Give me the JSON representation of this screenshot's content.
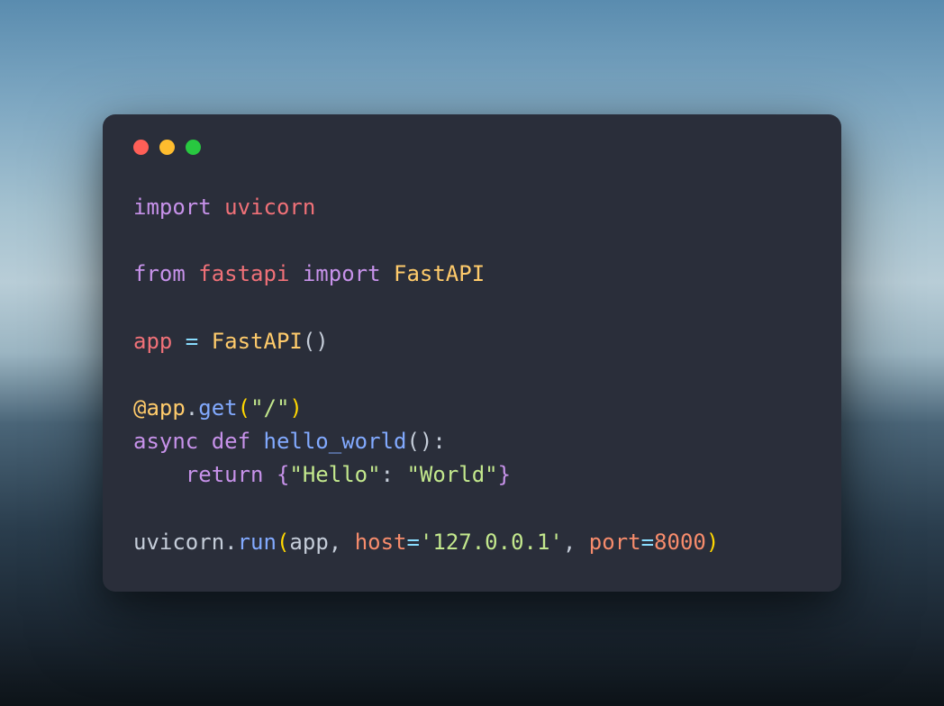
{
  "code": {
    "lines": [
      {
        "tokens": [
          {
            "t": "import ",
            "c": "tok-keyword"
          },
          {
            "t": "uvicorn",
            "c": "tok-module"
          }
        ]
      },
      {
        "tokens": [
          {
            "t": " ",
            "c": ""
          }
        ]
      },
      {
        "tokens": [
          {
            "t": "from ",
            "c": "tok-keyword"
          },
          {
            "t": "fastapi ",
            "c": "tok-module"
          },
          {
            "t": "import ",
            "c": "tok-keyword"
          },
          {
            "t": "FastAPI",
            "c": "tok-class"
          }
        ]
      },
      {
        "tokens": [
          {
            "t": " ",
            "c": ""
          }
        ]
      },
      {
        "tokens": [
          {
            "t": "app ",
            "c": "tok-name"
          },
          {
            "t": "= ",
            "c": "tok-op"
          },
          {
            "t": "FastAPI",
            "c": "tok-class"
          },
          {
            "t": "()",
            "c": "tok-punct"
          }
        ]
      },
      {
        "tokens": [
          {
            "t": " ",
            "c": ""
          }
        ]
      },
      {
        "tokens": [
          {
            "t": "@app",
            "c": "tok-attr"
          },
          {
            "t": ".",
            "c": "tok-punct"
          },
          {
            "t": "get",
            "c": "tok-method"
          },
          {
            "t": "(",
            "c": "tok-paren"
          },
          {
            "t": "\"/\"",
            "c": "tok-string"
          },
          {
            "t": ")",
            "c": "tok-paren"
          }
        ]
      },
      {
        "tokens": [
          {
            "t": "async ",
            "c": "tok-keyword"
          },
          {
            "t": "def ",
            "c": "tok-keyword"
          },
          {
            "t": "hello_world",
            "c": "tok-func"
          },
          {
            "t": "():",
            "c": "tok-punct"
          }
        ]
      },
      {
        "tokens": [
          {
            "t": "    ",
            "c": ""
          },
          {
            "t": "return ",
            "c": "tok-keyword"
          },
          {
            "t": "{",
            "c": "tok-brace"
          },
          {
            "t": "\"Hello\"",
            "c": "tok-string"
          },
          {
            "t": ": ",
            "c": "tok-punct"
          },
          {
            "t": "\"World\"",
            "c": "tok-string"
          },
          {
            "t": "}",
            "c": "tok-brace"
          }
        ]
      },
      {
        "tokens": [
          {
            "t": " ",
            "c": ""
          }
        ]
      },
      {
        "tokens": [
          {
            "t": "uvicorn",
            "c": "tok-self"
          },
          {
            "t": ".",
            "c": "tok-punct"
          },
          {
            "t": "run",
            "c": "tok-method"
          },
          {
            "t": "(",
            "c": "tok-paren"
          },
          {
            "t": "app",
            "c": "tok-self"
          },
          {
            "t": ", ",
            "c": "tok-punct"
          },
          {
            "t": "host",
            "c": "tok-param"
          },
          {
            "t": "=",
            "c": "tok-op"
          },
          {
            "t": "'127.0.0.1'",
            "c": "tok-string"
          },
          {
            "t": ", ",
            "c": "tok-punct"
          },
          {
            "t": "port",
            "c": "tok-param"
          },
          {
            "t": "=",
            "c": "tok-op"
          },
          {
            "t": "8000",
            "c": "tok-number"
          },
          {
            "t": ")",
            "c": "tok-paren"
          }
        ]
      }
    ]
  },
  "window": {
    "dots": [
      "close",
      "minimize",
      "maximize"
    ]
  }
}
